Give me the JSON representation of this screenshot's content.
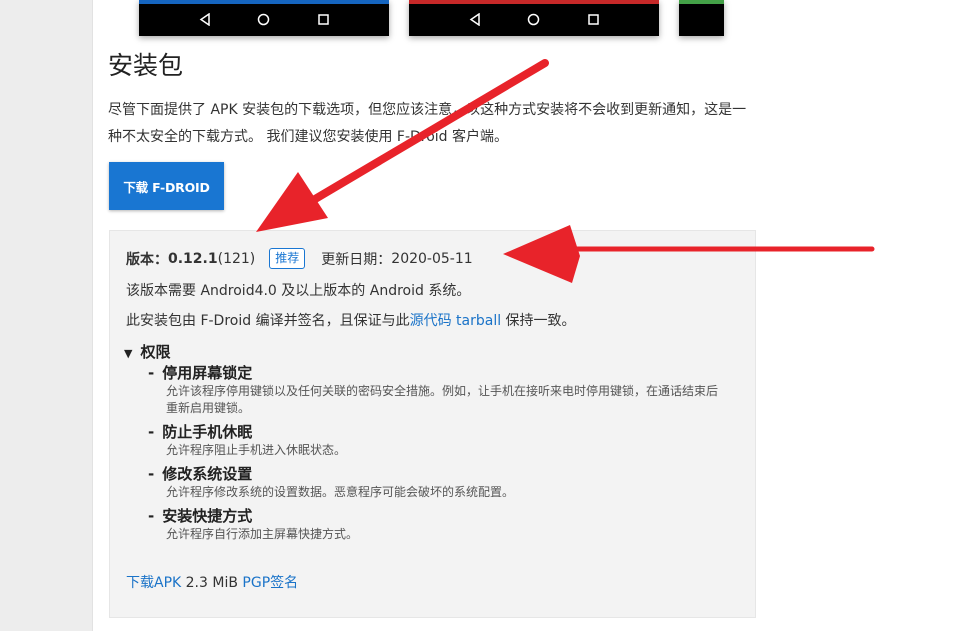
{
  "section": {
    "title": "安装包",
    "description": "尽管下面提供了 APK 安装包的下载选项，但您应该注意，以这种方式安装将不会收到更新通知，这是一种不太安全的下载方式。 我们建议您安装使用 F-Droid 客户端。",
    "download_button": "下载 F-DROID"
  },
  "screenshots": [
    {
      "accent": "#1565c0",
      "nav": [
        "back-icon",
        "home-icon",
        "recents-icon"
      ]
    },
    {
      "accent": "#c62828",
      "nav": [
        "back-icon",
        "home-icon",
        "recents-icon"
      ]
    },
    {
      "accent": "#43a047",
      "nav": []
    }
  ],
  "version": {
    "label": "版本：",
    "number": "0.12.1",
    "code": "(121)",
    "badge": "推荐",
    "updated_label": "更新日期：",
    "updated_date": "2020-05-11",
    "requirement": "该版本需要 Android4.0 及以上版本的 Android 系统。",
    "signed_prefix": "此安装包由 F-Droid 编译并签名，且保证与此",
    "source_link": "源代码 tarball",
    "signed_suffix": " 保持一致。"
  },
  "permissions": {
    "toggle": "▼",
    "heading": "权限",
    "items": [
      {
        "title": "停用屏幕锁定",
        "desc": "允许该程序停用键锁以及任何关联的密码安全措施。例如，让手机在接听来电时停用键锁，在通话结束后重新启用键锁。"
      },
      {
        "title": "防止手机休眠",
        "desc": "允许程序阻止手机进入休眠状态。"
      },
      {
        "title": "修改系统设置",
        "desc": "允许程序修改系统的设置数据。恶意程序可能会破坏的系统配置。"
      },
      {
        "title": "安装快捷方式",
        "desc": "允许程序自行添加主屏幕快捷方式。"
      }
    ]
  },
  "footer": {
    "download_apk": "下载APK",
    "size": " 2.3 MiB ",
    "pgp": "PGP签名"
  },
  "colors": {
    "accent": "#1976d2",
    "link": "#1a73c8",
    "arrow": "#e8232a"
  }
}
